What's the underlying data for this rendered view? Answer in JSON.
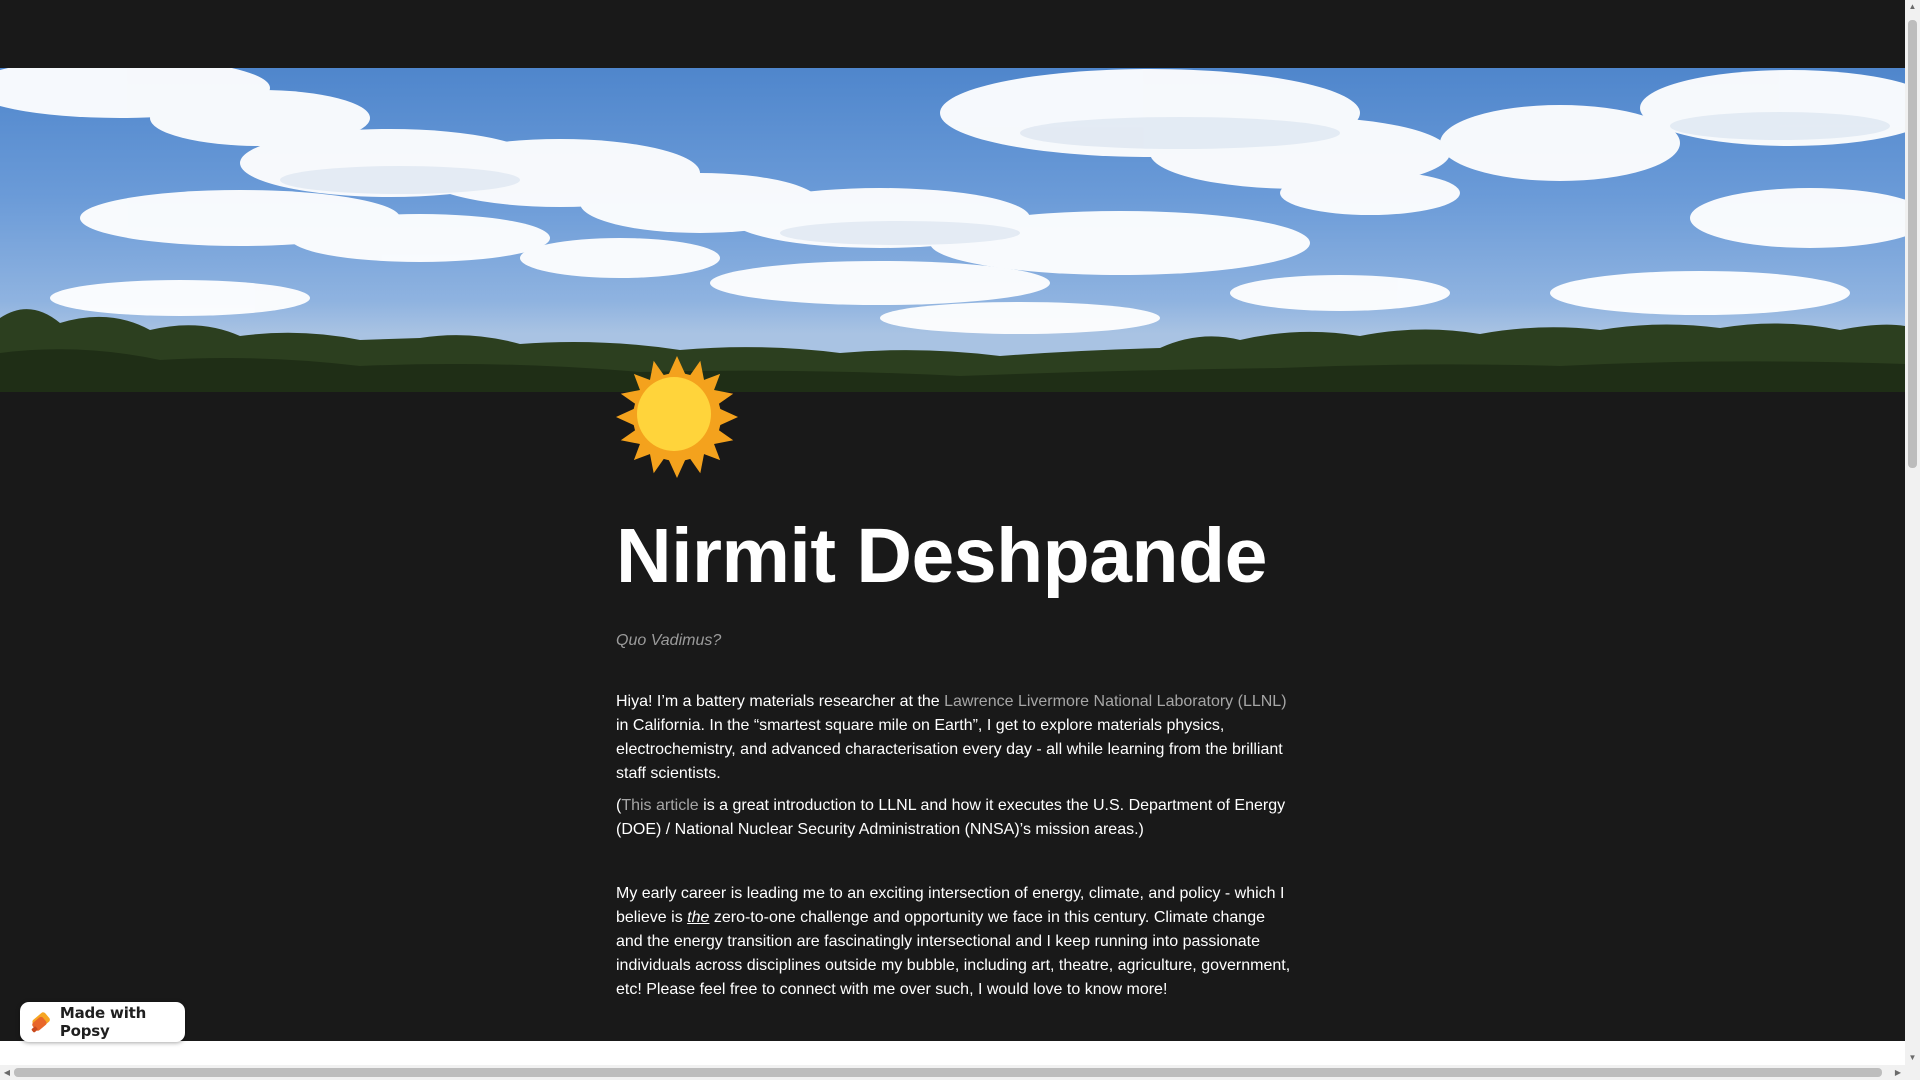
{
  "page_icon": {
    "name": "sun-icon",
    "colors": {
      "rays": "#f4a21d",
      "disc": "#ffd43b"
    }
  },
  "header": {
    "title": "Nirmit Deshpande",
    "subtitle": "Quo Vadimus?"
  },
  "intro": {
    "prefix": "Hiya! I’m a battery materials researcher at the ",
    "link_text": "Lawrence Livermore National Laboratory (LLNL)",
    "suffix": " in California. In the “smartest square mile on Earth”, I get to explore materials physics, electrochemistry, and advanced characterisation every day - all while learning from the brilliant staff scientists."
  },
  "article": {
    "open_paren": "(",
    "link_text": "This article",
    "suffix": " is a great introduction to LLNL and how it executes the U.S. Department of Energy (DOE) / National Nuclear Security Administration (NNSA)’s mission areas.)"
  },
  "career": {
    "prefix": "My early career is leading me to an exciting intersection of energy, climate, and policy - which I believe is ",
    "emphasis": "the",
    "suffix": " zero-to-one challenge and opportunity we face in this century. Climate change and the energy transition are fascinatingly intersectional and I keep running into passionate individuals across disciplines outside my bubble, including art, theatre, agriculture, government, etc! Please feel free to connect with me over such, I would love to know more!"
  },
  "badge": {
    "label": "Made with Popsy",
    "icon": "popsy-logo-icon"
  },
  "scrollbars": {
    "up": "▲",
    "down": "▼",
    "left": "◀",
    "right": "▶"
  }
}
